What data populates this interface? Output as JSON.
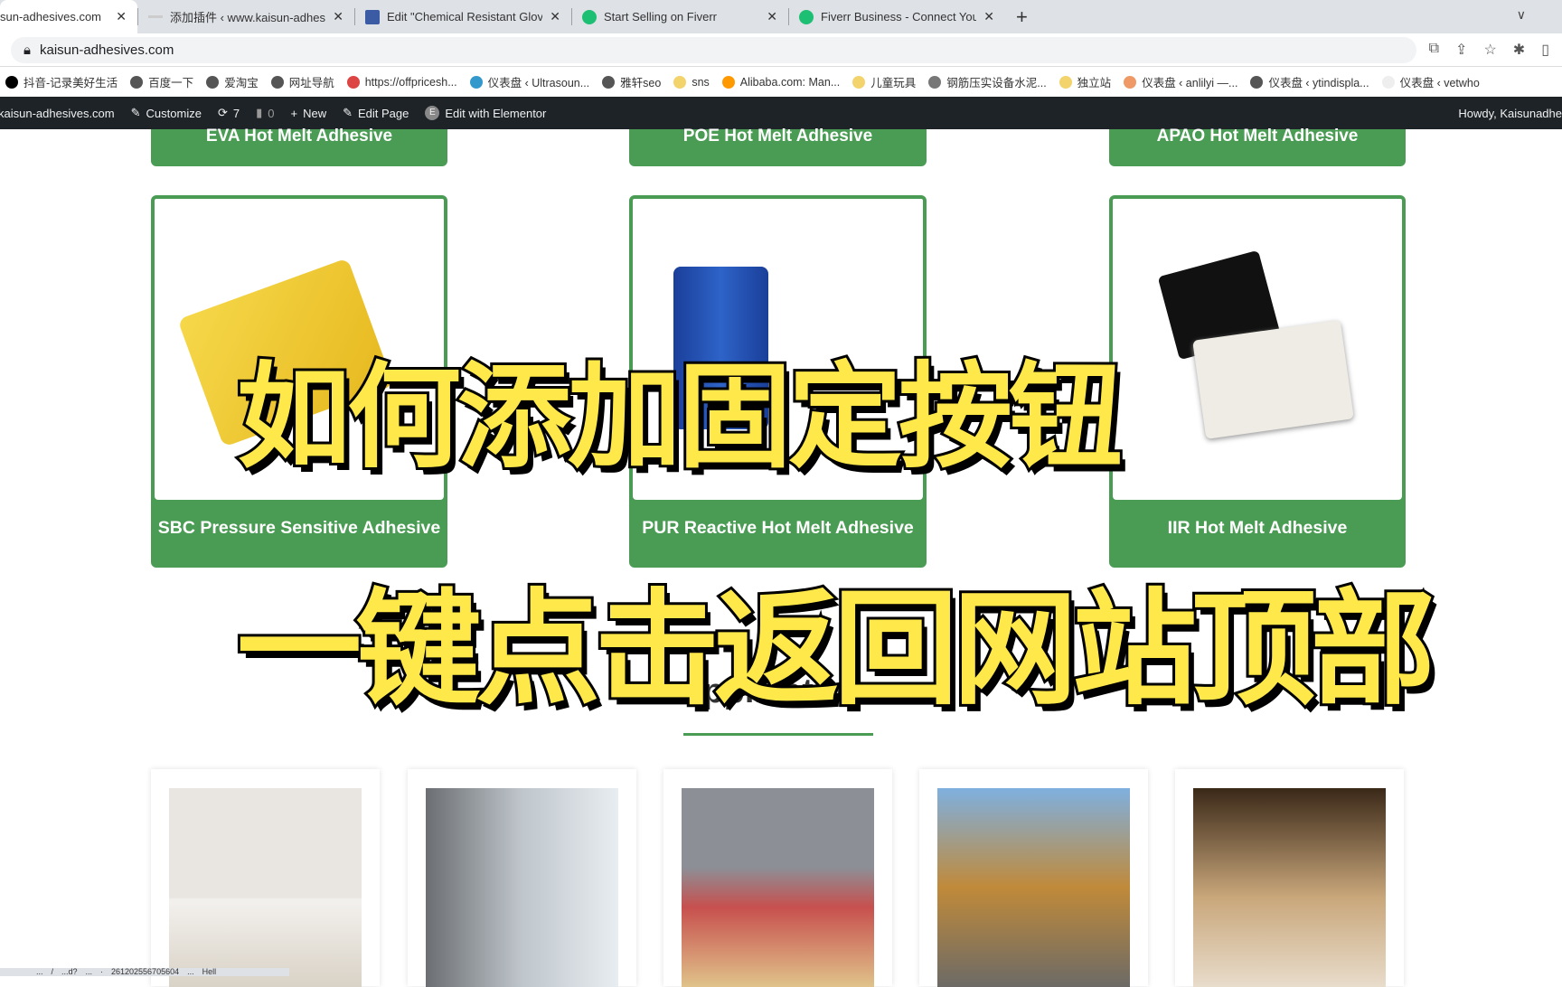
{
  "browser": {
    "tabs": [
      {
        "label": "sun-adhesives.com",
        "active": true
      },
      {
        "label": "添加插件 ‹ www.kaisun-adhesiv",
        "favicon": "wp-icon"
      },
      {
        "label": "Edit \"Chemical Resistant Glove",
        "favicon": "plugin-icon"
      },
      {
        "label": "Start Selling on Fiverr",
        "favicon": "fiverr-icon"
      },
      {
        "label": "Fiverr Business - Connect Your",
        "favicon": "fiverr-icon"
      }
    ],
    "url": "kaisun-adhesives.com",
    "bookmarks": [
      "抖音-记录美好生活",
      "百度一下",
      "爱淘宝",
      "网址导航",
      "https://offpricesh...",
      "仪表盘 ‹ Ultrasoun...",
      "雅轩seo",
      "sns",
      "Alibaba.com: Man...",
      "儿童玩具",
      "钢筋压实设备水泥...",
      "独立站",
      "仪表盘 ‹ anlilyi —...",
      "仪表盘 ‹ ytindispla...",
      "仪表盘 ‹ vetwho"
    ]
  },
  "wpbar": {
    "site": "kaisun-adhesives.com",
    "customize": "Customize",
    "updates": "7",
    "comments": "0",
    "new": "New",
    "edit_page": "Edit Page",
    "elementor": "Edit with Elementor",
    "howdy": "Howdy, Kaisunadhe"
  },
  "products_top": [
    "EVA Hot Melt Adhesive",
    "POE Hot Melt Adhesive",
    "APAO Hot Melt Adhesive"
  ],
  "products": [
    "SBC Pressure Sensitive Adhesive",
    "PUR Reactive Hot Melt Adhesive",
    "IIR Hot Melt Adhesive"
  ],
  "overlay": {
    "line1": "如何添加固定按钮",
    "line2": "一键点击返回网站顶部"
  },
  "applications": {
    "title": "Applications"
  },
  "status_url": "...　/　...d?　...　·　261202556705604　...　Hell",
  "colors": {
    "green": "#4a9c54",
    "overlay_yellow": "#ffe94a",
    "admin_bar": "#1d2327"
  }
}
